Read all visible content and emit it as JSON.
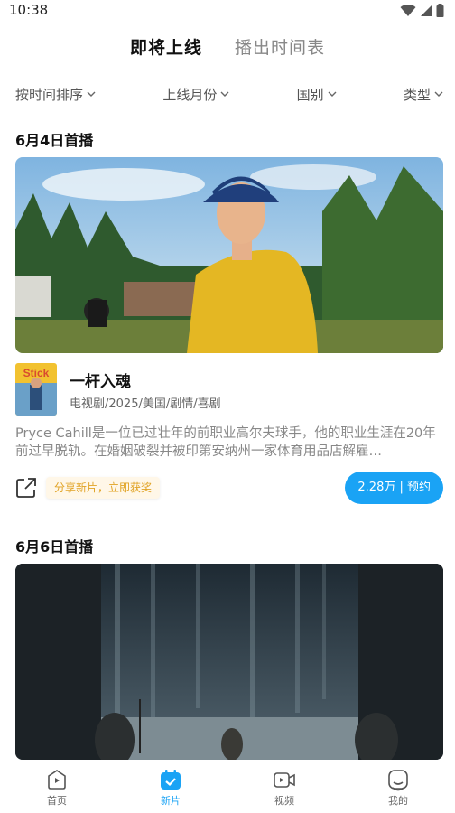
{
  "status_bar": {
    "time": "10:38"
  },
  "top_tabs": [
    {
      "label": "即将上线",
      "active": true
    },
    {
      "label": "播出时间表",
      "active": false
    }
  ],
  "filters": [
    {
      "label": "按时间排序"
    },
    {
      "label": "上线月份"
    },
    {
      "label": "国别"
    },
    {
      "label": "类型"
    }
  ],
  "sections": [
    {
      "date": "6月4日首播",
      "show": {
        "title": "一杆入魂",
        "meta": "电视剧/2025/美国/剧情/喜剧",
        "poster_text": "Stick",
        "description": "Pryce Cahill是一位已过壮年的前职业高尔夫球手，他的职业生涯在20年前过早脱轨。在婚姻破裂并被印第安纳州一家体育用品店解雇…",
        "promo": "分享新片，立即获奖",
        "reserve": "2.28万 | 预约"
      }
    },
    {
      "date": "6月6日首播"
    }
  ],
  "bottom_nav": [
    {
      "label": "首页",
      "icon": "home-play-icon",
      "active": false
    },
    {
      "label": "新片",
      "icon": "calendar-check-icon",
      "active": true
    },
    {
      "label": "视频",
      "icon": "video-camera-icon",
      "active": false
    },
    {
      "label": "我的",
      "icon": "profile-icon",
      "active": false
    }
  ],
  "colors": {
    "accent": "#1aa3f5",
    "promo_text": "#e1a325"
  }
}
